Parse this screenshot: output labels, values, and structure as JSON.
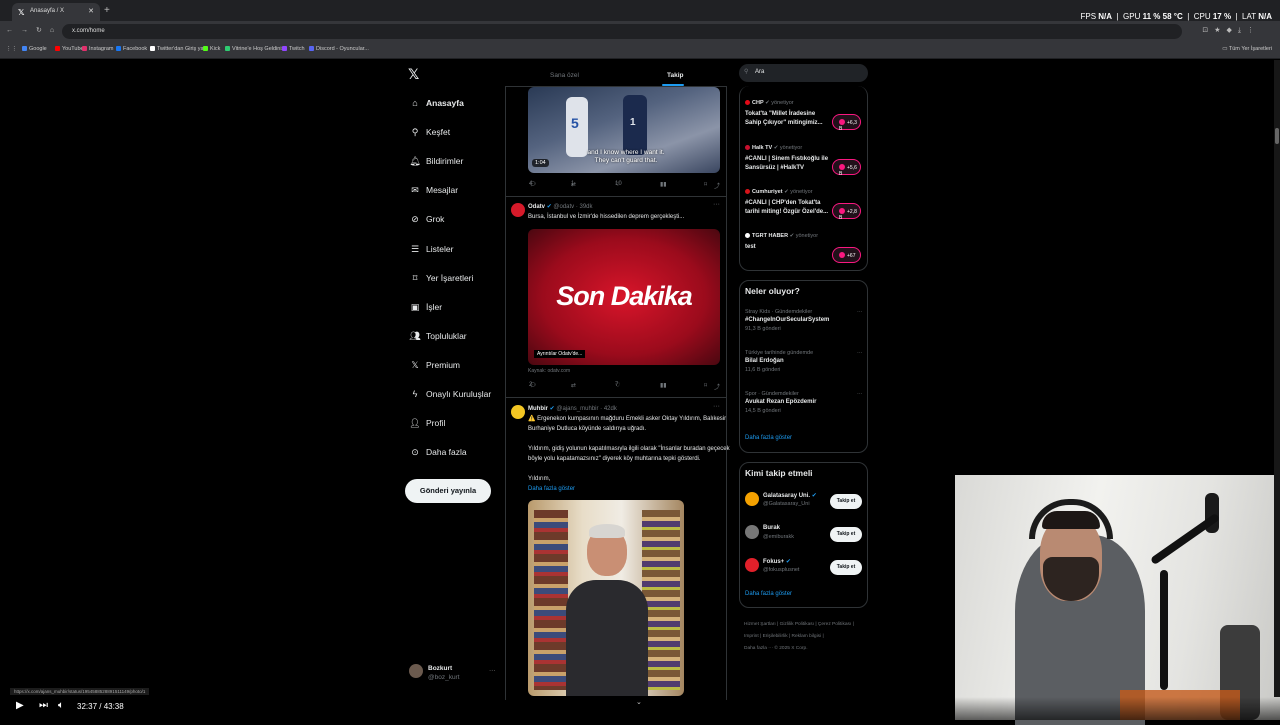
{
  "browser": {
    "tab_title": "Anasayfa / X",
    "url": "x.com/home",
    "all_bookmarks": "Tüm Yer İşaretleri",
    "bookmarks": [
      {
        "label": "Google",
        "color": "#4285f4"
      },
      {
        "label": "YouTube",
        "color": "#ff0000"
      },
      {
        "label": "Instagram",
        "color": "#e1306c"
      },
      {
        "label": "Facebook",
        "color": "#1877f2"
      },
      {
        "label": "Twitter'dan Giriş yap",
        "color": "#ffffff"
      },
      {
        "label": "Kick",
        "color": "#53fc18"
      },
      {
        "label": "Vitrine'e Hoş Geldiniz",
        "color": "#2ecc71"
      },
      {
        "label": "Twitch",
        "color": "#9146ff"
      },
      {
        "label": "Discord - Oyuncular...",
        "color": "#5865f2"
      }
    ]
  },
  "overlay": {
    "fps_label": "FPS",
    "fps_value": "N/A",
    "gpu_label": "GPU",
    "gpu_value": "11 %",
    "gpu_temp": "58 °C",
    "cpu_label": "CPU",
    "cpu_value": "17 %",
    "lat_label": "LAT",
    "lat_value": "N/A"
  },
  "nav": {
    "items": [
      {
        "label": "Anasayfa",
        "icon": "home-icon"
      },
      {
        "label": "Keşfet",
        "icon": "search-icon"
      },
      {
        "label": "Bildirimler",
        "icon": "bell-icon"
      },
      {
        "label": "Mesajlar",
        "icon": "mail-icon"
      },
      {
        "label": "Grok",
        "icon": "grok-icon"
      },
      {
        "label": "Listeler",
        "icon": "list-icon"
      },
      {
        "label": "Yer İşaretleri",
        "icon": "bookmark-icon"
      },
      {
        "label": "İşler",
        "icon": "briefcase-icon"
      },
      {
        "label": "Topluluklar",
        "icon": "people-icon"
      },
      {
        "label": "Premium",
        "icon": "x-logo-icon"
      },
      {
        "label": "Onaylı Kuruluşlar",
        "icon": "lightning-icon"
      },
      {
        "label": "Profil",
        "icon": "person-icon"
      },
      {
        "label": "Daha fazla",
        "icon": "more-circle-icon"
      }
    ],
    "post_button": "Gönderi yayınla",
    "account": {
      "name": "Bozkurt",
      "handle": "@boz_kurt"
    }
  },
  "feed": {
    "tabs": [
      "Sana özel",
      "Takip"
    ],
    "video": {
      "duration": "1:04",
      "caption": "and I know where I want it. They can't guard that.",
      "jersey_left": "5",
      "jersey_right": "1",
      "stats": {
        "replies": "4",
        "reposts": "1",
        "likes": "10"
      }
    },
    "post2": {
      "name": "Odatv",
      "handle": "@odatv · 39dk",
      "text": "Bursa, İstanbul ve İzmir'de hissedilen deprem gerçekleşti...",
      "image_title": "Son Dakika",
      "image_sub": "Ayrıntılar Odatv'de...",
      "source": "Kaynak: odatv.com",
      "stats": {
        "replies": "2",
        "reposts": "",
        "likes": "7"
      }
    },
    "post3": {
      "name": "Muhbir",
      "handle": "@ajans_muhbir · 42dk",
      "line1": "⚠️ Ergenekon kumpasının mağduru Emekli asker Oktay Yıldırım, Balıkesir",
      "line2": "Burhaniye Dutluca köyünde saldırıya uğradı.",
      "line3": "Yıldırım, gidiş yolunun kapatılmasıyla ilgili olarak \"İnsanlar buradan geçecek",
      "line4": "böyle yolu kapatamazsınız\" diyerek köy muhtarına tepki gösterdi.",
      "line5": "Yıldırım,",
      "show_more": "Daha fazla göster"
    },
    "link_preview": "https://x.com/ajans_muhbir/status/1954588528891511149/photo/1"
  },
  "right": {
    "search_placeholder": "Ara",
    "spaces": [
      {
        "source": "CHP",
        "status": "yönetiyor",
        "title1": "Tokat'ta \"Millet İradesine",
        "title2": "Sahip Çıkıyor\" mitingimiz...",
        "count": "+6,3 B",
        "color": "#e30a17"
      },
      {
        "source": "Halk TV",
        "status": "yönetiyor",
        "title1": "#CANLI | Sinem Fıstıkoğlu ile",
        "title2": "Sansürsüz | #HalkTV",
        "count": "+5,6 B",
        "color": "#c8102e"
      },
      {
        "source": "Cumhuriyet",
        "status": "yönetiyor",
        "title1": "#CANLI | CHP'den Tokat'ta",
        "title2": "tarihi miting! Özgür Özel'de...",
        "count": "+2,8 B",
        "color": "#d7141a"
      },
      {
        "source": "TGRT HABER",
        "status": "yönetiyor",
        "title1": "test",
        "title2": "",
        "count": "+67",
        "color": "#ffffff"
      }
    ],
    "trends_title": "Neler oluyor?",
    "trends": [
      {
        "context": "Stray Kids · Gündemdekiler",
        "name": "#ChangeInOurSecularSystem",
        "count": "91,3 B gönderi"
      },
      {
        "context": "Türkiye tarihinde gündemde",
        "name": "Bilal Erdoğan",
        "count": "11,6 B gönderi"
      },
      {
        "context": "Spor · Gündemdekiler",
        "name": "Avukat Rezan Epözdemir",
        "count": "14,5 B gönderi"
      }
    ],
    "show_more": "Daha fazla göster",
    "who_title": "Kimi takip etmeli",
    "who": [
      {
        "name": "Galatasaray Uni.",
        "handle": "@Galatasaray_Uni",
        "color": "#f4a100"
      },
      {
        "name": "Burak",
        "handle": "@emiburakk",
        "color": "#777777"
      },
      {
        "name": "Fokus+",
        "handle": "@fokusplusnet",
        "color": "#e0202a"
      }
    ],
    "follow_label": "Takip et",
    "footer": [
      "Hizmet Şartları | Gizlilik Politikası | Çerez Politikası |",
      "Imprint | Erişilebilirlik | Reklam bilgisi |",
      "Daha fazla ··· © 2025 X Corp."
    ]
  },
  "player": {
    "time": "32:37 / 43:38"
  }
}
